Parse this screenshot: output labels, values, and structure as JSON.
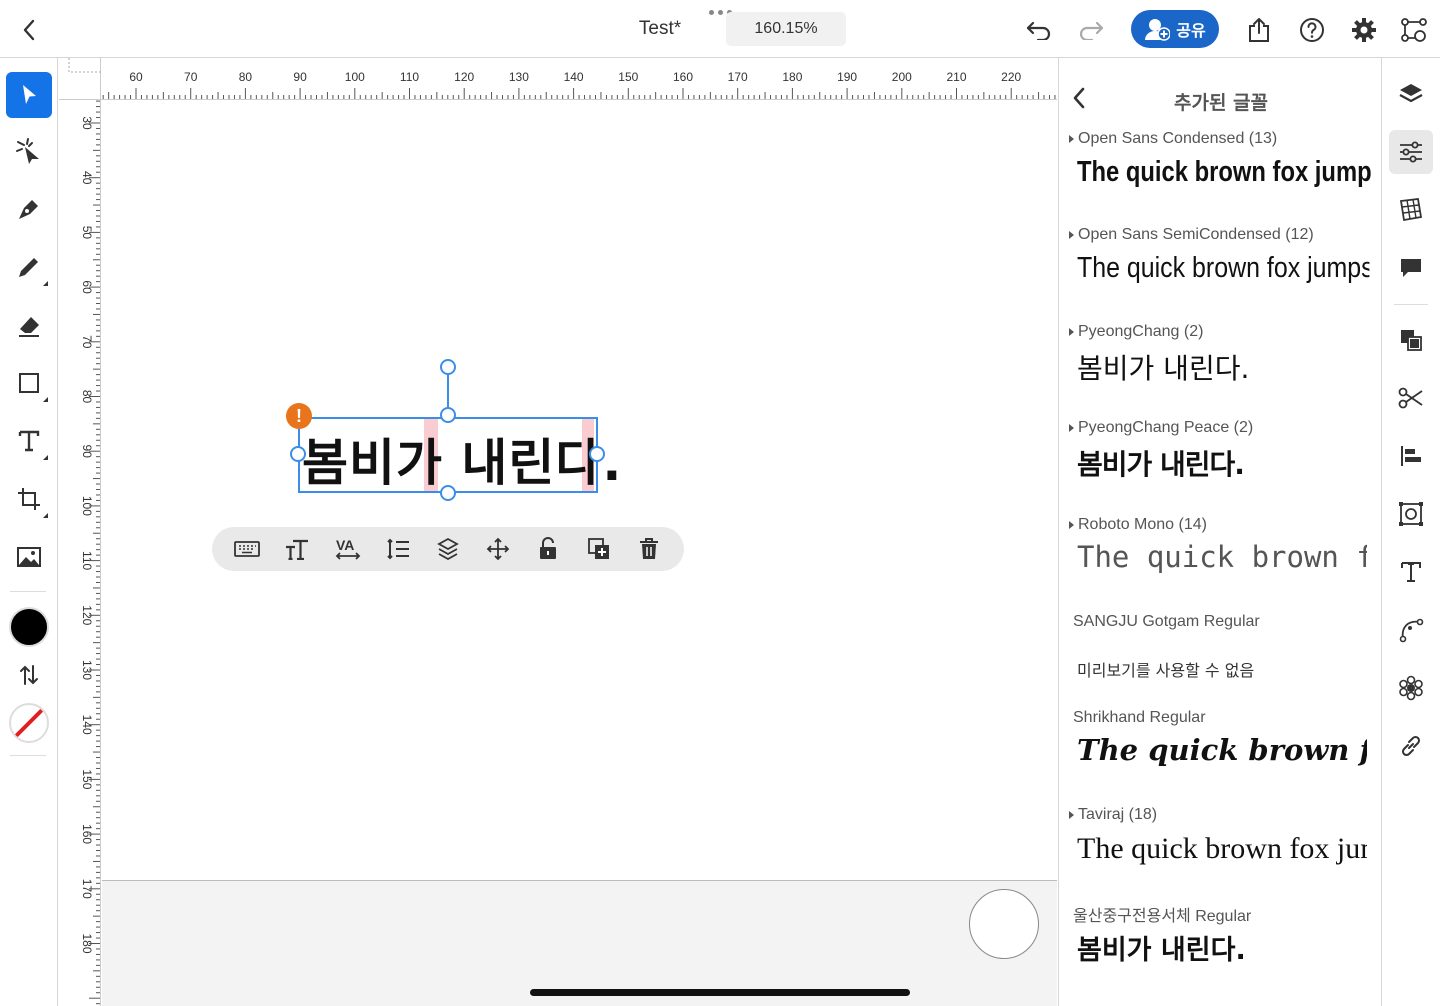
{
  "header": {
    "document_title": "Test*",
    "zoom_level": "160.15%",
    "share_label": "공유"
  },
  "rulers": {
    "top_ticks": [
      "60",
      "70",
      "80",
      "90",
      "100",
      "110",
      "120",
      "130",
      "140",
      "150",
      "160",
      "170",
      "180",
      "190",
      "200",
      "210",
      "220"
    ],
    "left_ticks": [
      "30",
      "40",
      "50",
      "60",
      "70",
      "80",
      "90",
      "100",
      "110",
      "120",
      "130",
      "140",
      "150",
      "160",
      "170",
      "180"
    ]
  },
  "canvas": {
    "text_content": "봄비가 내린다.",
    "warning_glyph": "!"
  },
  "colors": {
    "accent": "#1473e6",
    "share_button": "#1a66c9",
    "selection": "#3b8ee8",
    "warning": "#e8741c",
    "fill": "#000000",
    "stroke_none": "#e02020"
  },
  "font_panel": {
    "title": "추가된 글꼴",
    "fonts": [
      {
        "name": "Open Sans Condensed (13)",
        "has_caret": true,
        "sample": "The quick brown fox jumps"
      },
      {
        "name": "Open Sans SemiCondensed (12)",
        "has_caret": true,
        "sample": "The quick brown fox jumps"
      },
      {
        "name": "PyeongChang (2)",
        "has_caret": true,
        "sample": "봄비가 내린다."
      },
      {
        "name": "PyeongChang Peace (2)",
        "has_caret": true,
        "sample": "봄비가 내린다."
      },
      {
        "name": "Roboto Mono (14)",
        "has_caret": true,
        "sample": "The quick brown fox"
      },
      {
        "name": "SANGJU Gotgam Regular",
        "has_caret": false,
        "sample": "미리보기를 사용할 수 없음"
      },
      {
        "name": "Shrikhand Regular",
        "has_caret": false,
        "sample": "The quick brown fox"
      },
      {
        "name": "Taviraj (18)",
        "has_caret": true,
        "sample": "The quick brown fox jumps"
      },
      {
        "name": "울산중구전용서체 Regular",
        "has_caret": false,
        "sample": "봄비가 내린다."
      }
    ]
  },
  "left_tools": [
    "selection-tool",
    "direct-selection-tool",
    "pen-tool",
    "pencil-tool",
    "eraser-tool",
    "shape-tool",
    "type-tool",
    "crop-tool",
    "image-tool"
  ],
  "right_rail": [
    "layers",
    "properties",
    "libraries",
    "comments",
    "arrange",
    "path-operations",
    "align",
    "repeat-grid",
    "text-on-path",
    "curvature",
    "pattern",
    "links"
  ],
  "context_toolbar": [
    "keyboard",
    "text-size",
    "character-spacing",
    "line-spacing",
    "arrange-layers",
    "move",
    "unlock",
    "duplicate",
    "delete"
  ]
}
